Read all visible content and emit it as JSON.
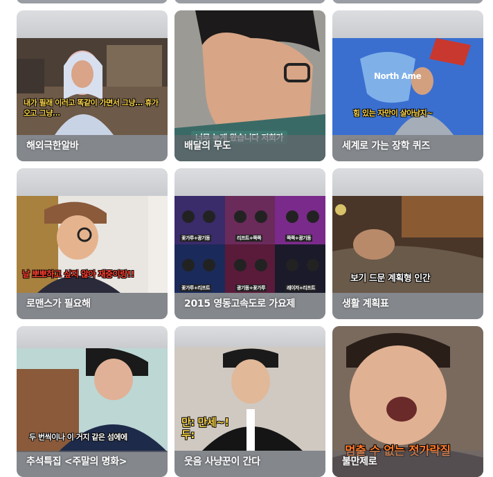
{
  "cards": [
    {
      "title": "해외극한알바",
      "subtitle": "내가 필래 이러고 똑같이 가면서 그냥... 휴가 오고 그냥..."
    },
    {
      "title": "배달의 무도",
      "subtitle": "너무 늦게 왔습니다 저희가"
    },
    {
      "title": "세계로 가는 장학 퀴즈",
      "subtitle": "힘 있는 자만이 살아남지~",
      "map_label": "North Ame"
    },
    {
      "title": "로맨스가 필요해",
      "subtitle": "날 뽀뽀하고 싶지 않아 재중이랑!!"
    },
    {
      "title": "2015 영동고속도로 가요제",
      "team_labels": [
        "꽃가루+광기동",
        "리프트+쪽쪽",
        "쪽쪽+광기동",
        "꽃가루+리프트",
        "광기동+꽃가루",
        "레이저+리프트"
      ]
    },
    {
      "title": "생활 계획표",
      "subtitle": "보기 드문 계획형 인간"
    },
    {
      "title": "추석특집 <주말의 명화>",
      "subtitle": "두 번씩이나 이 거지 같은 섬에에"
    },
    {
      "title": "웃음 사냥꾼이 간다",
      "subtitle_lines": [
        "만: 만세~!",
        "두:"
      ]
    },
    {
      "title": "불만제로",
      "subtitle": "멈출 수 없는 젓가락질"
    }
  ]
}
